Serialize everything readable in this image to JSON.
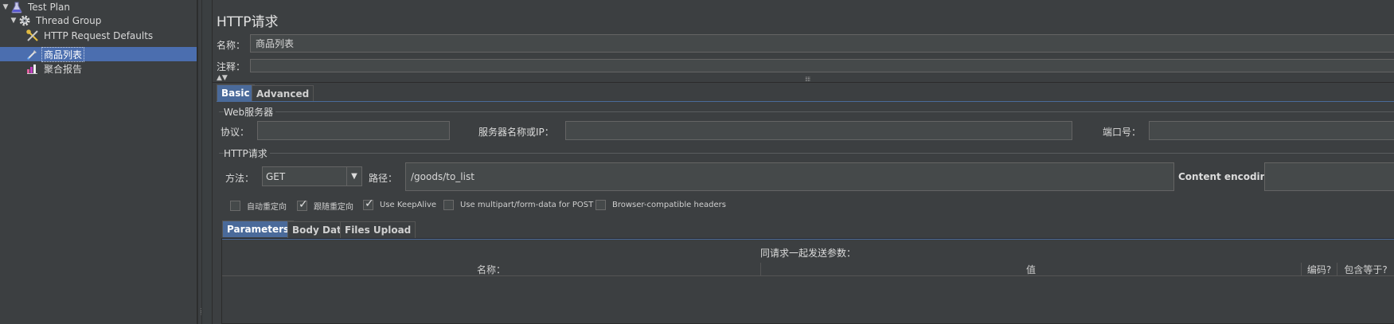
{
  "tree": {
    "items": [
      {
        "label": "Test Plan",
        "icon": "flask-icon",
        "expanded": true
      },
      {
        "label": "Thread Group",
        "icon": "gear-icon",
        "expanded": true
      },
      {
        "label": "HTTP Request Defaults",
        "icon": "wrench-screwdriver-icon"
      },
      {
        "label": "商品列表",
        "icon": "pipette-icon",
        "selected": true
      },
      {
        "label": "聚合报告",
        "icon": "report-chart-icon"
      }
    ]
  },
  "main": {
    "title": "HTTP请求",
    "name_label": "名称：",
    "name_value": "商品列表",
    "comment_label": "注释：",
    "comment_value": "",
    "tabs": [
      "Basic",
      "Advanced"
    ],
    "active_tab": "Basic",
    "web_server": {
      "group_title": "Web服务器",
      "protocol_label": "协议：",
      "protocol_value": "",
      "server_label": "服务器名称或IP：",
      "server_value": "",
      "port_label": "端口号：",
      "port_value": ""
    },
    "http_request": {
      "group_title": "HTTP请求",
      "method_label": "方法：",
      "method_value": "GET",
      "path_label": "路径：",
      "path_value": "/goods/to_list",
      "encoding_label": "Content encoding:",
      "encoding_value": ""
    },
    "checkboxes": [
      {
        "label": "自动重定向",
        "checked": false
      },
      {
        "label": "跟随重定向",
        "checked": true
      },
      {
        "label": "Use KeepAlive",
        "checked": true
      },
      {
        "label": "Use multipart/form-data for POST",
        "checked": false
      },
      {
        "label": "Browser-compatible headers",
        "checked": false
      }
    ],
    "param_tabs": [
      "Parameters",
      "Body Data",
      "Files Upload"
    ],
    "active_param_tab": "Parameters",
    "params_caption": "同请求一起发送参数：",
    "columns": [
      "名称：",
      "值",
      "编码?",
      "包含等于?"
    ]
  },
  "colors": {
    "background": "#3c3f41",
    "selection": "#4b6eaf",
    "field_bg": "#45494a"
  }
}
